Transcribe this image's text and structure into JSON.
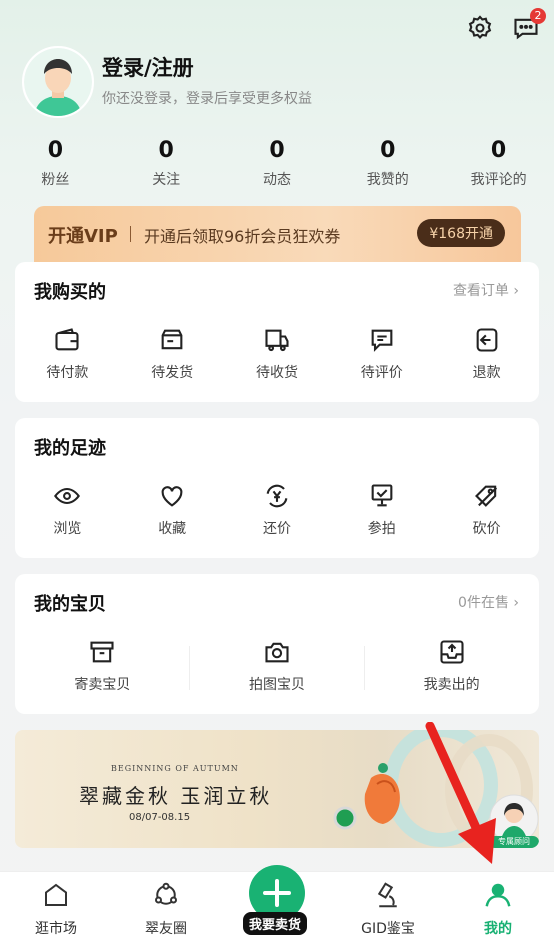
{
  "header": {
    "message_badge": "2"
  },
  "user": {
    "title": "登录/注册",
    "subtitle": "你还没登录，登录后享受更多权益"
  },
  "stats": [
    {
      "value": "0",
      "label": "粉丝"
    },
    {
      "value": "0",
      "label": "关注"
    },
    {
      "value": "0",
      "label": "动态"
    },
    {
      "value": "0",
      "label": "我赞的"
    },
    {
      "value": "0",
      "label": "我评论的"
    }
  ],
  "vip": {
    "title": "开通VIP",
    "text": "开通后领取96折会员狂欢券",
    "button": "¥168开通"
  },
  "purchases": {
    "title": "我购买的",
    "link": "查看订单 ›",
    "items": [
      {
        "label": "待付款",
        "icon": "wallet-icon"
      },
      {
        "label": "待发货",
        "icon": "box-icon"
      },
      {
        "label": "待收货",
        "icon": "truck-icon"
      },
      {
        "label": "待评价",
        "icon": "comment-icon"
      },
      {
        "label": "退款",
        "icon": "refund-icon"
      }
    ]
  },
  "footprints": {
    "title": "我的足迹",
    "items": [
      {
        "label": "浏览",
        "icon": "eye-icon"
      },
      {
        "label": "收藏",
        "icon": "heart-icon"
      },
      {
        "label": "还价",
        "icon": "yen-exchange-icon"
      },
      {
        "label": "参拍",
        "icon": "auction-icon"
      },
      {
        "label": "砍价",
        "icon": "price-cut-icon"
      }
    ]
  },
  "treasures": {
    "title": "我的宝贝",
    "link": "0件在售 ›",
    "items": [
      {
        "label": "寄卖宝贝",
        "icon": "archive-icon"
      },
      {
        "label": "拍图宝贝",
        "icon": "camera-icon"
      },
      {
        "label": "我卖出的",
        "icon": "upload-tray-icon"
      }
    ]
  },
  "banner": {
    "small": "BEGINNING OF AUTUMN",
    "main": "翠藏金秋 玉润立秋",
    "date": "08/07-08.15",
    "advisor": "专属顾问"
  },
  "tabbar": [
    {
      "label": "逛市场",
      "icon": "home-icon"
    },
    {
      "label": "翠友圈",
      "icon": "circle-nodes-icon"
    },
    {
      "label": "我要卖货",
      "icon": "plus-icon"
    },
    {
      "label": "GID鉴宝",
      "icon": "microscope-icon"
    },
    {
      "label": "我的",
      "icon": "user-icon",
      "active": true
    }
  ],
  "colors": {
    "accent": "#19b273",
    "vip_dark": "#4a2d19",
    "annotation_arrow": "#e8231f"
  }
}
